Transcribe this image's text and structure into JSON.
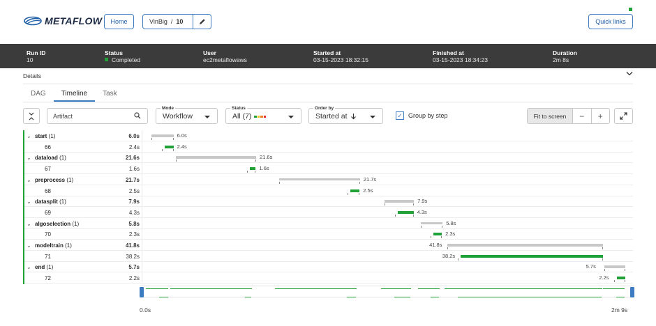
{
  "app": {
    "logo_text": "METAFLOW"
  },
  "nav": {
    "home_label": "Home",
    "flow": "VinBig",
    "run": "10",
    "sep": "/",
    "quick_links_label": "Quick links"
  },
  "run_info": {
    "run_id_label": "Run ID",
    "run_id": "10",
    "status_label": "Status",
    "status": "Completed",
    "user_label": "User",
    "user": "ec2metaflowaws",
    "started_label": "Started at",
    "started": "03-15-2023 18:32:15",
    "finished_label": "Finished at",
    "finished": "03-15-2023 18:34:23",
    "duration_label": "Duration",
    "duration": "2m 8s"
  },
  "details_label": "Details",
  "tabs": [
    {
      "label": "DAG",
      "active": false
    },
    {
      "label": "Timeline",
      "active": true
    },
    {
      "label": "Task",
      "active": false
    }
  ],
  "controls": {
    "search_placeholder": "Artifact",
    "mode_label": "Mode",
    "mode_value": "Workflow",
    "status_label": "Status",
    "status_value": "All (7)",
    "status_colors": [
      "#20a238",
      "#e8c31d",
      "#f07d24",
      "#e0302a"
    ],
    "order_label": "Order by",
    "order_value": "Started at",
    "group_by_step_label": "Group by step",
    "group_by_step_checked": true,
    "fit_label": "Fit to screen",
    "zoom_out": "−",
    "zoom_in": "+"
  },
  "timeline_total_seconds": 129,
  "rows": [
    {
      "type": "step",
      "name": "start",
      "count": "(1)",
      "duration": "6.0s",
      "start_s": 0.3,
      "dur_s": 6.0
    },
    {
      "type": "task",
      "name": "66",
      "duration": "2.4s",
      "start_s": 3.9,
      "dur_s": 2.4
    },
    {
      "type": "step",
      "name": "dataload",
      "count": "(1)",
      "duration": "21.6s",
      "start_s": 6.9,
      "dur_s": 21.6
    },
    {
      "type": "task",
      "name": "67",
      "duration": "1.6s",
      "start_s": 26.8,
      "dur_s": 1.6
    },
    {
      "type": "step",
      "name": "preprocess",
      "count": "(1)",
      "duration": "21.7s",
      "start_s": 34.7,
      "dur_s": 21.7
    },
    {
      "type": "task",
      "name": "68",
      "duration": "2.5s",
      "start_s": 53.8,
      "dur_s": 2.5
    },
    {
      "type": "step",
      "name": "datasplit",
      "count": "(1)",
      "duration": "7.9s",
      "start_s": 63.0,
      "dur_s": 7.9
    },
    {
      "type": "task",
      "name": "69",
      "duration": "4.3s",
      "start_s": 66.5,
      "dur_s": 4.3
    },
    {
      "type": "step",
      "name": "algoselection",
      "count": "(1)",
      "duration": "5.8s",
      "start_s": 72.8,
      "dur_s": 5.8
    },
    {
      "type": "task",
      "name": "70",
      "duration": "2.3s",
      "start_s": 76.1,
      "dur_s": 2.3
    },
    {
      "type": "step",
      "name": "modeltrain",
      "count": "(1)",
      "duration": "41.8s",
      "start_s": 79.9,
      "dur_s": 41.8
    },
    {
      "type": "task",
      "name": "71",
      "duration": "38.2s",
      "start_s": 83.4,
      "dur_s": 38.2
    },
    {
      "type": "step",
      "name": "end",
      "count": "(1)",
      "duration": "5.7s",
      "start_s": 122.0,
      "dur_s": 5.7
    },
    {
      "type": "task",
      "name": "72",
      "duration": "2.2s",
      "start_s": 125.5,
      "dur_s": 2.2
    }
  ],
  "axis": {
    "start": "0.0s",
    "end": "2m 9s"
  }
}
